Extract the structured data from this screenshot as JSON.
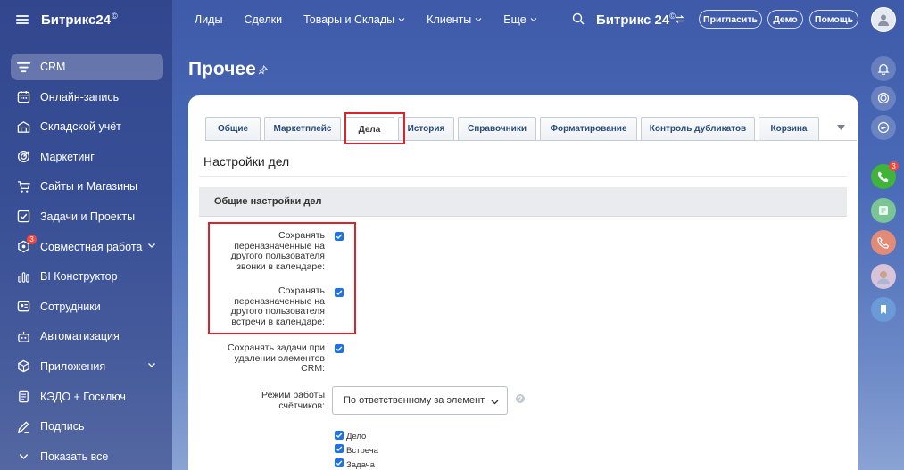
{
  "sidebar": {
    "brand": "Битрикс24",
    "brand_mark": "©",
    "items": [
      {
        "label": "CRM",
        "icon": "filter-icon",
        "active": true
      },
      {
        "label": "Онлайн-запись",
        "icon": "calendar-icon"
      },
      {
        "label": "Складской учёт",
        "icon": "warehouse-icon"
      },
      {
        "label": "Маркетинг",
        "icon": "target-icon"
      },
      {
        "label": "Сайты и Магазины",
        "icon": "cart-icon"
      },
      {
        "label": "Задачи и Проекты",
        "icon": "checkbox-icon"
      },
      {
        "label": "Совместная работа",
        "icon": "collab-icon",
        "badge": "3",
        "expandable": true
      },
      {
        "label": "BI Конструктор",
        "icon": "chart-icon"
      },
      {
        "label": "Сотрудники",
        "icon": "people-icon"
      },
      {
        "label": "Автоматизация",
        "icon": "robot-icon"
      },
      {
        "label": "Приложения",
        "icon": "box-icon",
        "expandable": true
      },
      {
        "label": "КЭДО + Госключ",
        "icon": "docs-icon"
      },
      {
        "label": "Подпись",
        "icon": "pen-icon"
      },
      {
        "label": "Показать все",
        "icon": "chevron-down-icon"
      }
    ]
  },
  "topnav": {
    "items": [
      {
        "label": "Лиды"
      },
      {
        "label": "Сделки"
      },
      {
        "label": "Товары и Склады",
        "dropdown": true
      },
      {
        "label": "Клиенты",
        "dropdown": true
      },
      {
        "label": "Еще",
        "dropdown": true
      }
    ],
    "brand": "Битрикс 24",
    "brand_mark": "©",
    "invite": "Пригласить",
    "demo": "Демо",
    "help": "Помощь"
  },
  "page": {
    "title": "Прочее"
  },
  "tabs": [
    {
      "label": "Общие"
    },
    {
      "label": "Маркетплейс"
    },
    {
      "label": "Дела",
      "active": true
    },
    {
      "label": "История"
    },
    {
      "label": "Справочники"
    },
    {
      "label": "Форматирование"
    },
    {
      "label": "Контроль дубликатов"
    },
    {
      "label": "Корзина"
    }
  ],
  "settings": {
    "section_title": "Настройки дел",
    "group_title": "Общие настройки дел",
    "options": [
      {
        "label_lines": [
          "Сохранять",
          "переназначенные на",
          "другого пользователя",
          "звонки в календаре:"
        ],
        "checked": true
      },
      {
        "label_lines": [
          "Сохранять",
          "переназначенные на",
          "другого пользователя",
          "встречи в календаре:"
        ],
        "checked": true
      },
      {
        "label_lines": [
          "Сохранять задачи при",
          "удалении элементов",
          "CRM:"
        ],
        "checked": true
      }
    ],
    "counter_mode": {
      "label_lines": [
        "Режим работы",
        "счётчиков:"
      ],
      "value": "По ответственному за элемент",
      "help": "?"
    },
    "activity_types": [
      {
        "label": "Дело",
        "checked": true
      },
      {
        "label": "Встреча",
        "checked": true
      },
      {
        "label": "Задача",
        "checked": true
      }
    ]
  },
  "colors": {
    "accent": "#1f73e0",
    "highlight": "#d9232d",
    "badge": "#f0483e"
  }
}
